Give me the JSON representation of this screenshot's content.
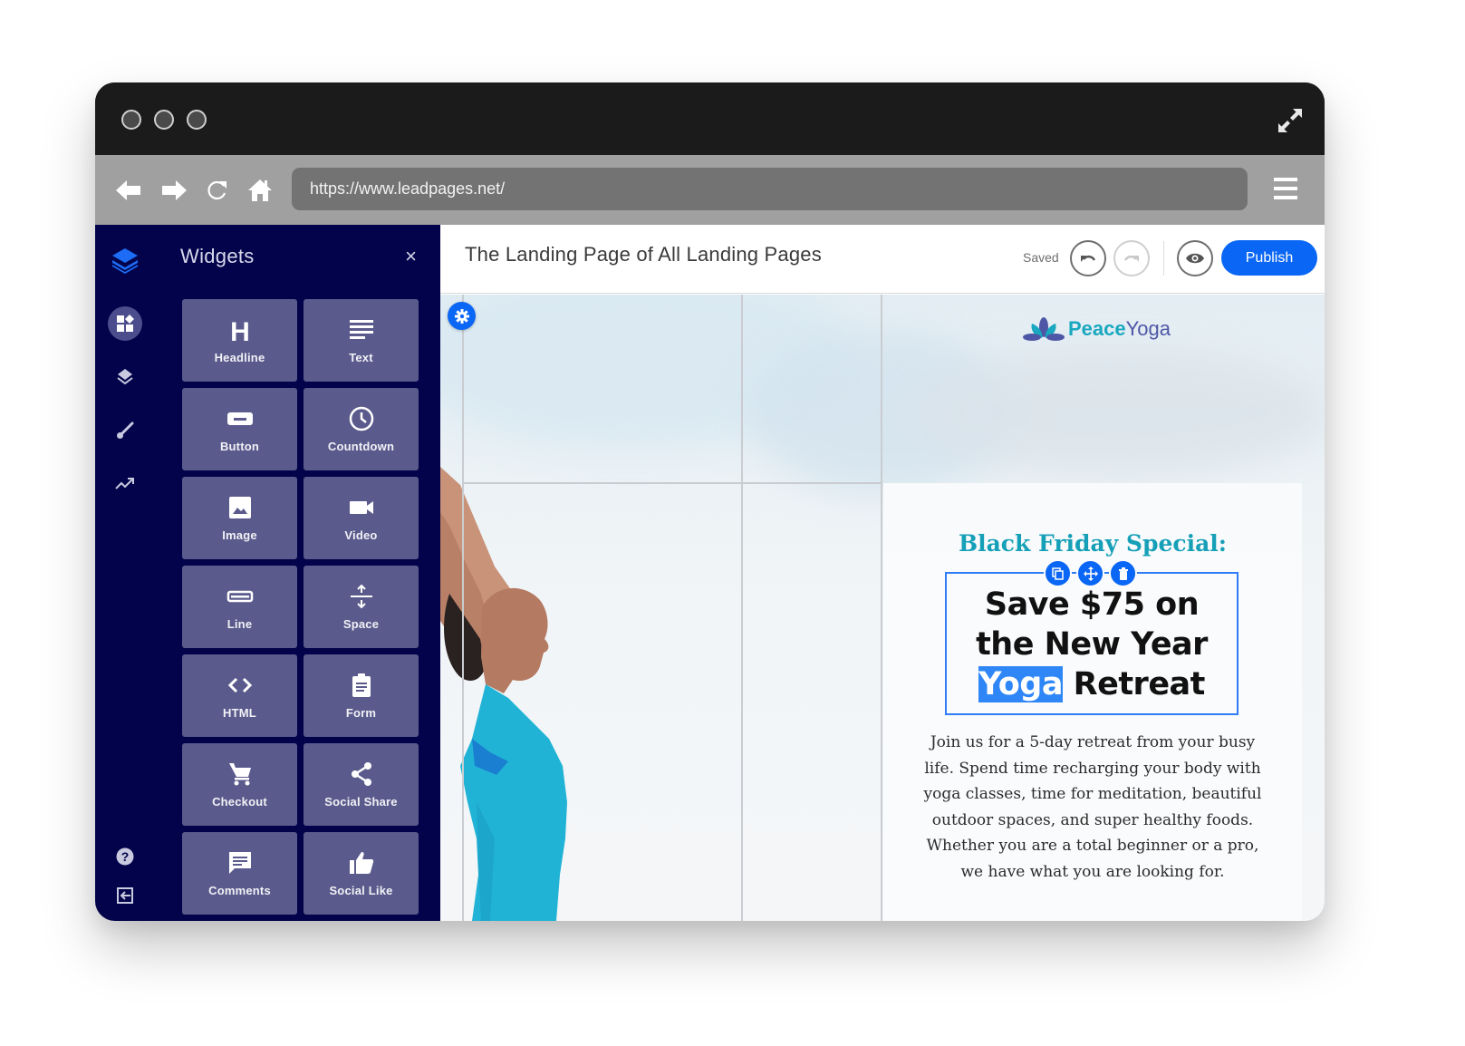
{
  "window": {
    "traffic_lights": [
      "close",
      "minimize",
      "zoom"
    ],
    "expand_icon": "expand-arrows-icon"
  },
  "browser": {
    "url": "https://www.leadpages.net/",
    "nav_icons": [
      "back-arrow-icon",
      "forward-arrow-icon",
      "reload-icon",
      "home-icon"
    ],
    "menu_icon": "hamburger-menu-icon"
  },
  "rail": {
    "items": [
      {
        "name": "leadpages-logo",
        "icon": "stacked-layers-logo-icon"
      },
      {
        "name": "widgets",
        "icon": "widgets-icon",
        "active": true
      },
      {
        "name": "layers",
        "icon": "layers-icon"
      },
      {
        "name": "styles",
        "icon": "paintbrush-icon"
      },
      {
        "name": "analytics",
        "icon": "trending-up-icon"
      },
      {
        "name": "help",
        "icon": "help-circle-icon"
      },
      {
        "name": "exit",
        "icon": "exit-icon"
      }
    ]
  },
  "widgets_panel": {
    "title": "Widgets",
    "close_label": "×",
    "tiles": [
      {
        "label": "Headline",
        "icon": "headline-h-icon"
      },
      {
        "label": "Text",
        "icon": "text-lines-icon"
      },
      {
        "label": "Button",
        "icon": "button-icon"
      },
      {
        "label": "Countdown",
        "icon": "clock-icon"
      },
      {
        "label": "Image",
        "icon": "image-icon"
      },
      {
        "label": "Video",
        "icon": "video-camera-icon"
      },
      {
        "label": "Line",
        "icon": "line-icon"
      },
      {
        "label": "Space",
        "icon": "space-arrows-icon"
      },
      {
        "label": "HTML",
        "icon": "code-brackets-icon"
      },
      {
        "label": "Form",
        "icon": "clipboard-form-icon"
      },
      {
        "label": "Checkout",
        "icon": "shopping-cart-icon"
      },
      {
        "label": "Social Share",
        "icon": "share-icon"
      },
      {
        "label": "Comments",
        "icon": "comment-icon"
      },
      {
        "label": "Social Like",
        "icon": "thumbs-up-icon"
      }
    ]
  },
  "editor": {
    "page_title": "The Landing Page of All Landing Pages",
    "status": "Saved",
    "publish_label": "Publish",
    "colors": {
      "accent": "#0a66f4",
      "sidebar": "#02034a",
      "tile": "#5a5b8c"
    }
  },
  "landing_page": {
    "logo": {
      "part1": "Peace",
      "part2": "Yoga"
    },
    "subheading": "Black Friday Special:",
    "headline": {
      "line1": "Save $75 on",
      "line2": "the New Year",
      "selected_word": "Yoga",
      "line3_rest": " Retreat"
    },
    "body": "Join us for a 5-day retreat from your busy life. Spend time recharging your body with yoga classes, time for meditation, beautiful outdoor spaces, and super healthy foods. Whether you are a total beginner or a pro, we have what you are looking for.",
    "colors": {
      "subheading": "#16a0b8",
      "selection": "#2f86f6"
    }
  }
}
